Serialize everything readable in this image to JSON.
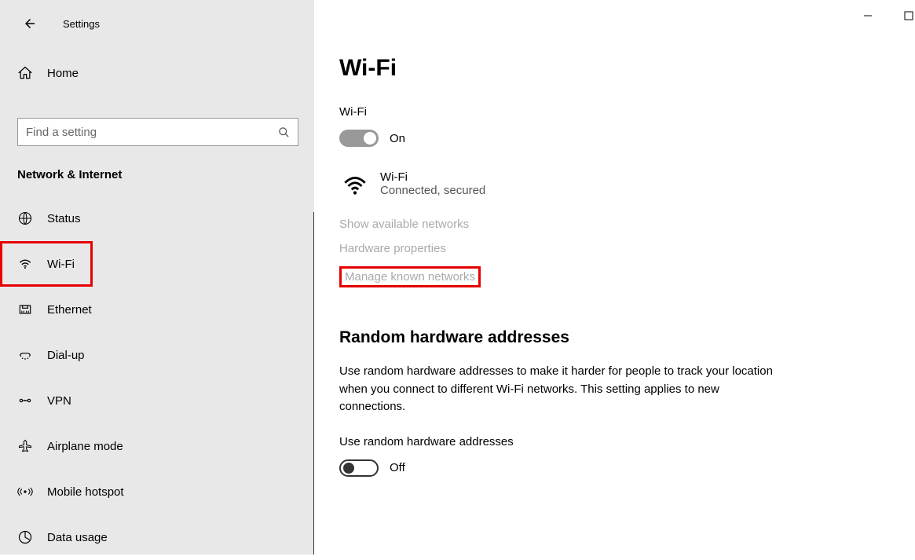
{
  "titlebar": {
    "title": "Settings"
  },
  "home": {
    "label": "Home"
  },
  "search": {
    "placeholder": "Find a setting"
  },
  "category": "Network & Internet",
  "nav": {
    "status": "Status",
    "wifi": "Wi-Fi",
    "ethernet": "Ethernet",
    "dialup": "Dial-up",
    "vpn": "VPN",
    "airplane": "Airplane mode",
    "hotspot": "Mobile hotspot",
    "datausage": "Data usage"
  },
  "main": {
    "title": "Wi-Fi",
    "wifi_label": "Wi-Fi",
    "wifi_toggle_state": "On",
    "network_name": "Wi-Fi",
    "network_status": "Connected, secured",
    "link_available": "Show available networks",
    "link_hardware": "Hardware properties",
    "link_manage": "Manage known networks",
    "random_header": "Random hardware addresses",
    "random_desc": "Use random hardware addresses to make it harder for people to track your location when you connect to different Wi-Fi networks. This setting applies to new connections.",
    "random_label": "Use random hardware addresses",
    "random_toggle_state": "Off"
  }
}
